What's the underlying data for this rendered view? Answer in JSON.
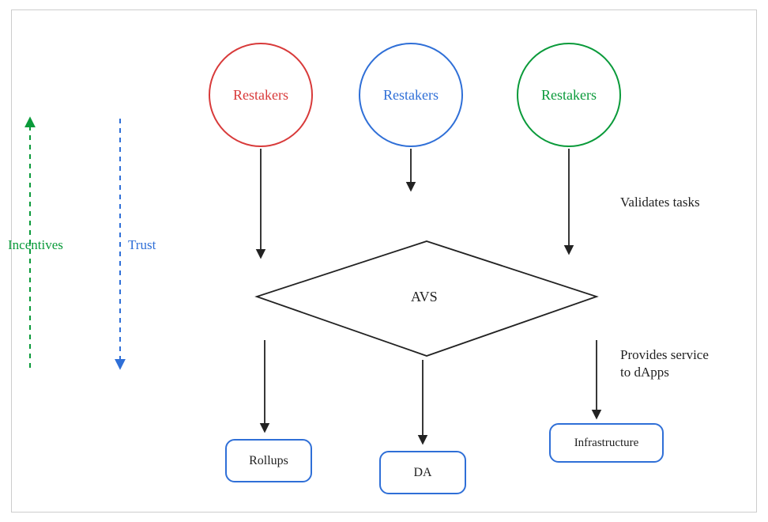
{
  "nodes": {
    "restaker1": "Restakers",
    "restaker2": "Restakers",
    "restaker3": "Restakers",
    "avs": "AVS",
    "rollups": "Rollups",
    "da": "DA",
    "infra": "Infrastructure"
  },
  "labels": {
    "incentives": "Incentives",
    "trust": "Trust",
    "validates": "Validates tasks",
    "provides": "Provides service\nto dApps"
  },
  "colors": {
    "red": "#d83a3a",
    "blue": "#2f6fd7",
    "green": "#0a9a3a",
    "black": "#222222"
  }
}
